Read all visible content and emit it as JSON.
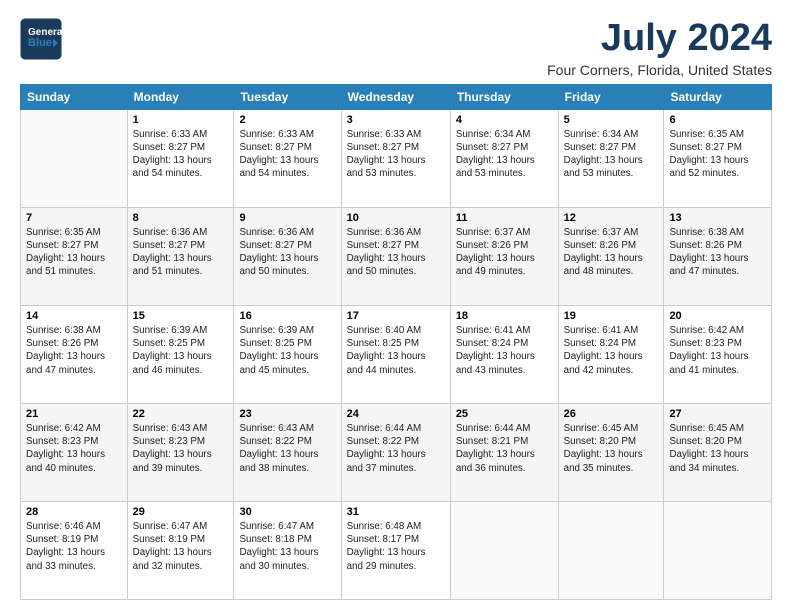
{
  "logo": {
    "line1": "General",
    "line2": "Blue",
    "arrow": "▶"
  },
  "title": "July 2024",
  "subtitle": "Four Corners, Florida, United States",
  "weekdays": [
    "Sunday",
    "Monday",
    "Tuesday",
    "Wednesday",
    "Thursday",
    "Friday",
    "Saturday"
  ],
  "weeks": [
    [
      {
        "day": "",
        "info": ""
      },
      {
        "day": "1",
        "info": "Sunrise: 6:33 AM\nSunset: 8:27 PM\nDaylight: 13 hours\nand 54 minutes."
      },
      {
        "day": "2",
        "info": "Sunrise: 6:33 AM\nSunset: 8:27 PM\nDaylight: 13 hours\nand 54 minutes."
      },
      {
        "day": "3",
        "info": "Sunrise: 6:33 AM\nSunset: 8:27 PM\nDaylight: 13 hours\nand 53 minutes."
      },
      {
        "day": "4",
        "info": "Sunrise: 6:34 AM\nSunset: 8:27 PM\nDaylight: 13 hours\nand 53 minutes."
      },
      {
        "day": "5",
        "info": "Sunrise: 6:34 AM\nSunset: 8:27 PM\nDaylight: 13 hours\nand 53 minutes."
      },
      {
        "day": "6",
        "info": "Sunrise: 6:35 AM\nSunset: 8:27 PM\nDaylight: 13 hours\nand 52 minutes."
      }
    ],
    [
      {
        "day": "7",
        "info": "Sunrise: 6:35 AM\nSunset: 8:27 PM\nDaylight: 13 hours\nand 51 minutes."
      },
      {
        "day": "8",
        "info": "Sunrise: 6:36 AM\nSunset: 8:27 PM\nDaylight: 13 hours\nand 51 minutes."
      },
      {
        "day": "9",
        "info": "Sunrise: 6:36 AM\nSunset: 8:27 PM\nDaylight: 13 hours\nand 50 minutes."
      },
      {
        "day": "10",
        "info": "Sunrise: 6:36 AM\nSunset: 8:27 PM\nDaylight: 13 hours\nand 50 minutes."
      },
      {
        "day": "11",
        "info": "Sunrise: 6:37 AM\nSunset: 8:26 PM\nDaylight: 13 hours\nand 49 minutes."
      },
      {
        "day": "12",
        "info": "Sunrise: 6:37 AM\nSunset: 8:26 PM\nDaylight: 13 hours\nand 48 minutes."
      },
      {
        "day": "13",
        "info": "Sunrise: 6:38 AM\nSunset: 8:26 PM\nDaylight: 13 hours\nand 47 minutes."
      }
    ],
    [
      {
        "day": "14",
        "info": "Sunrise: 6:38 AM\nSunset: 8:26 PM\nDaylight: 13 hours\nand 47 minutes."
      },
      {
        "day": "15",
        "info": "Sunrise: 6:39 AM\nSunset: 8:25 PM\nDaylight: 13 hours\nand 46 minutes."
      },
      {
        "day": "16",
        "info": "Sunrise: 6:39 AM\nSunset: 8:25 PM\nDaylight: 13 hours\nand 45 minutes."
      },
      {
        "day": "17",
        "info": "Sunrise: 6:40 AM\nSunset: 8:25 PM\nDaylight: 13 hours\nand 44 minutes."
      },
      {
        "day": "18",
        "info": "Sunrise: 6:41 AM\nSunset: 8:24 PM\nDaylight: 13 hours\nand 43 minutes."
      },
      {
        "day": "19",
        "info": "Sunrise: 6:41 AM\nSunset: 8:24 PM\nDaylight: 13 hours\nand 42 minutes."
      },
      {
        "day": "20",
        "info": "Sunrise: 6:42 AM\nSunset: 8:23 PM\nDaylight: 13 hours\nand 41 minutes."
      }
    ],
    [
      {
        "day": "21",
        "info": "Sunrise: 6:42 AM\nSunset: 8:23 PM\nDaylight: 13 hours\nand 40 minutes."
      },
      {
        "day": "22",
        "info": "Sunrise: 6:43 AM\nSunset: 8:23 PM\nDaylight: 13 hours\nand 39 minutes."
      },
      {
        "day": "23",
        "info": "Sunrise: 6:43 AM\nSunset: 8:22 PM\nDaylight: 13 hours\nand 38 minutes."
      },
      {
        "day": "24",
        "info": "Sunrise: 6:44 AM\nSunset: 8:22 PM\nDaylight: 13 hours\nand 37 minutes."
      },
      {
        "day": "25",
        "info": "Sunrise: 6:44 AM\nSunset: 8:21 PM\nDaylight: 13 hours\nand 36 minutes."
      },
      {
        "day": "26",
        "info": "Sunrise: 6:45 AM\nSunset: 8:20 PM\nDaylight: 13 hours\nand 35 minutes."
      },
      {
        "day": "27",
        "info": "Sunrise: 6:45 AM\nSunset: 8:20 PM\nDaylight: 13 hours\nand 34 minutes."
      }
    ],
    [
      {
        "day": "28",
        "info": "Sunrise: 6:46 AM\nSunset: 8:19 PM\nDaylight: 13 hours\nand 33 minutes."
      },
      {
        "day": "29",
        "info": "Sunrise: 6:47 AM\nSunset: 8:19 PM\nDaylight: 13 hours\nand 32 minutes."
      },
      {
        "day": "30",
        "info": "Sunrise: 6:47 AM\nSunset: 8:18 PM\nDaylight: 13 hours\nand 30 minutes."
      },
      {
        "day": "31",
        "info": "Sunrise: 6:48 AM\nSunset: 8:17 PM\nDaylight: 13 hours\nand 29 minutes."
      },
      {
        "day": "",
        "info": ""
      },
      {
        "day": "",
        "info": ""
      },
      {
        "day": "",
        "info": ""
      }
    ]
  ]
}
